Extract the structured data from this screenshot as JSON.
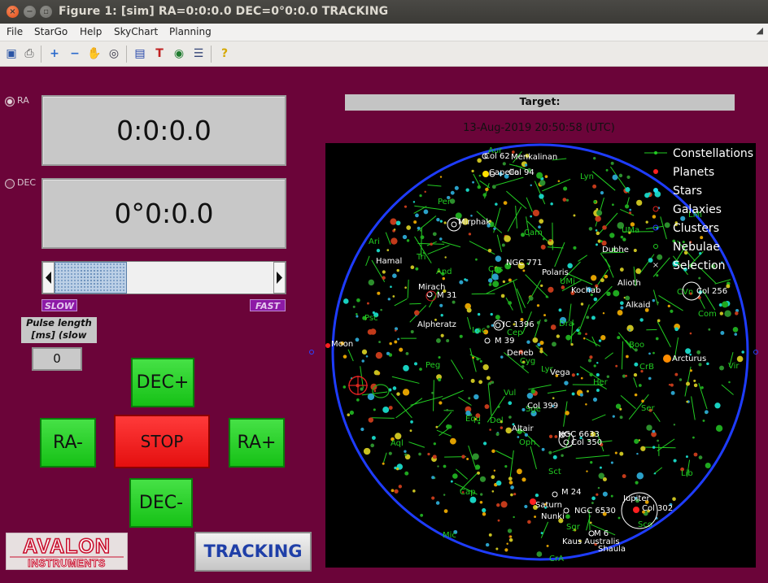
{
  "window": {
    "title": "Figure 1: [sim] RA=0:0:0.0 DEC=0°0:0.0 TRACKING",
    "close_glyph": "×",
    "minimize_glyph": "−",
    "maximize_glyph": "▫"
  },
  "menu": {
    "items": [
      "File",
      "StarGo",
      "Help",
      "SkyChart",
      "Planning"
    ]
  },
  "toolbar": {
    "icons": [
      "save-icon",
      "print-icon",
      "zoom-in-icon",
      "zoom-out-icon",
      "pan-hand-icon",
      "home-view-icon",
      "book-icon",
      "text-tool-icon",
      "globe-icon",
      "properties-icon",
      "help-icon"
    ],
    "glyphs": [
      "▣",
      "⎙",
      "+",
      "−",
      "✋",
      "◎",
      "▤",
      "T",
      "◉",
      "☰",
      "?"
    ]
  },
  "colors": {
    "panel": "#6b0439",
    "button_green": "#1fc91f",
    "button_red": "#ff2020",
    "sky_circle": "#1e3cff",
    "constellation": "#22cc22"
  },
  "axes_select": {
    "ra_label": "RA",
    "dec_label": "DEC",
    "selected": "RA"
  },
  "readouts": {
    "ra": "0:0:0.0",
    "dec": "0°0:0.0"
  },
  "speed": {
    "slow_label": "SLOW",
    "fast_label": "FAST",
    "level": 0.2
  },
  "pulse": {
    "label_line1": "Pulse length",
    "label_line2": "[ms] (slow",
    "value": "0"
  },
  "controls": {
    "dec_plus": "DEC+",
    "dec_minus": "DEC-",
    "ra_minus": "RA-",
    "ra_plus": "RA+",
    "stop": "STOP",
    "tracking": "TRACKING"
  },
  "logo": {
    "line1": "AVALON",
    "line2": "INSTRUMENTS"
  },
  "skychart": {
    "target_label": "Target:",
    "timestamp": "13-Aug-2019 20:50:58 (UTC)",
    "legend": [
      "Constellations",
      "Planets",
      "Stars",
      "Galaxies",
      "Clusters",
      "Nebulae",
      "Selection"
    ],
    "object_labels": [
      "Col 62",
      "Menkalinan",
      "Capella",
      "Col 94",
      "Mirphak",
      "Hamal",
      "NGC 771",
      "Polaris",
      "Kochab",
      "Alioth",
      "Alkaid",
      "Dubhe",
      "Col 256",
      "Mirach",
      "M 31",
      "Alpheratz",
      "IC 1396",
      "M 39",
      "Deneb",
      "Vega",
      "Arcturus",
      "Moon",
      "Col 399",
      "Altair",
      "NGC 6633",
      "Col 350",
      "M 24",
      "Saturn",
      "NGC 6530",
      "Nunki",
      "Jupiter",
      "Col 302",
      "M 6",
      "Kaus Australis",
      "Shaula"
    ],
    "constellation_labels": [
      "Aur",
      "Lyn",
      "Per",
      "Cam",
      "UMa",
      "LMi",
      "Ari",
      "Tri",
      "And",
      "Cas",
      "UMi",
      "CVn",
      "Com",
      "Psc",
      "Lac",
      "Cep",
      "Dra",
      "Boo",
      "Peg",
      "Cyg",
      "Lyr",
      "Her",
      "CrB",
      "Vir",
      "Vul",
      "Sge",
      "Ser",
      "Equ",
      "Del",
      "Aql",
      "Oph",
      "Cap",
      "Sct",
      "Lib",
      "Mic",
      "Sgr",
      "Sco",
      "CrA"
    ]
  }
}
